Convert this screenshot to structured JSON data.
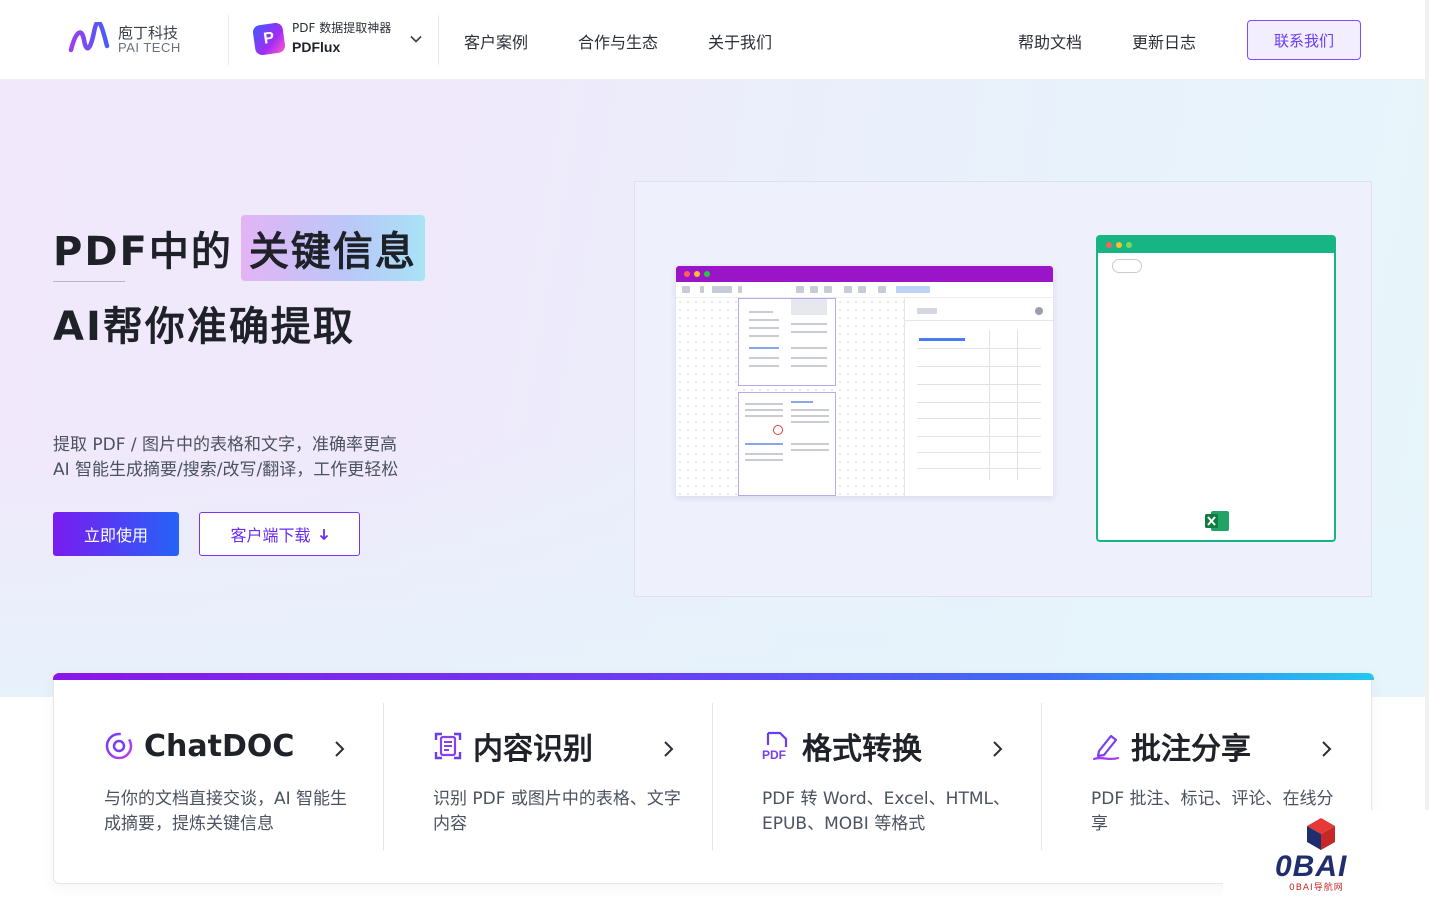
{
  "header": {
    "logo_cn": "庖丁科技",
    "logo_en": "PAI TECH",
    "product_line1": "PDF 数据提取神器",
    "product_line2": "PDFlux",
    "nav": [
      "客户案例",
      "合作与生态",
      "关于我们"
    ],
    "nav_right": [
      "帮助文档",
      "更新日志"
    ],
    "contact": "联系我们"
  },
  "hero": {
    "title_prefix": "PDF中的",
    "title_highlight": "关键信息",
    "subtitle": "AI帮你准确提取",
    "desc_line1": "提取 PDF / 图片中的表格和文字，准确率更高",
    "desc_line2": "AI 智能生成摘要/搜索/改写/翻译，工作更轻松",
    "btn_primary": "立即使用",
    "btn_download": "客户端下载"
  },
  "features": [
    {
      "title": "ChatDOC",
      "desc": "与你的文档直接交谈，AI 智能生成摘要，提炼关键信息",
      "icon": "chatdoc-icon"
    },
    {
      "title": "内容识别",
      "desc": "识别 PDF 或图片中的表格、文字内容",
      "icon": "scan-doc-icon"
    },
    {
      "title": "格式转换",
      "desc": "PDF 转 Word、Excel、HTML、EPUB、MOBI 等格式",
      "icon": "pdf-convert-icon"
    },
    {
      "title": "批注分享",
      "desc": "PDF 批注、标记、评论、在线分享",
      "icon": "annotate-pen-icon"
    }
  ],
  "watermark": {
    "brand": "0BAI",
    "sub": "0BAI导航网"
  },
  "colors": {
    "accent": "#6a3df2",
    "brand_gradient_start": "#7a1bf0",
    "brand_gradient_end": "#2563f7",
    "excel_green": "#18b584"
  }
}
